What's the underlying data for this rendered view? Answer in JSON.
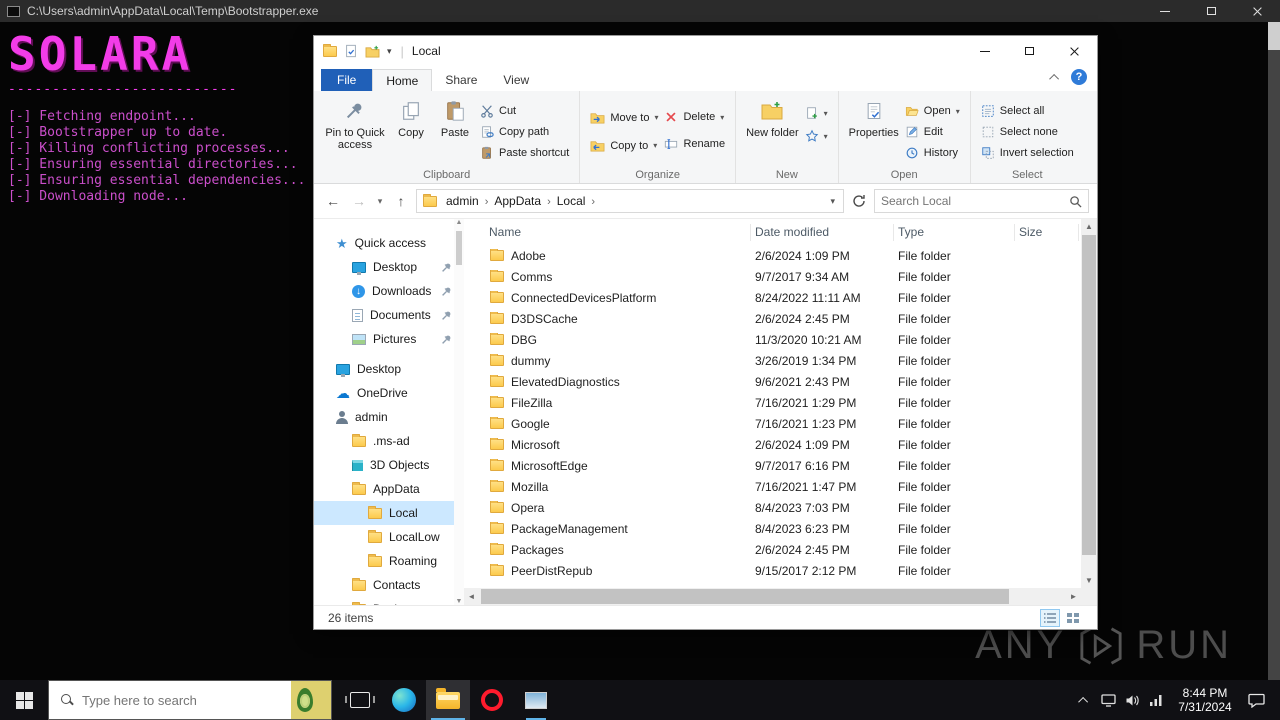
{
  "console": {
    "title": "C:\\Users\\admin\\AppData\\Local\\Temp\\Bootstrapper.exe",
    "logo_text": "SOLARA",
    "divider": "--------------------------",
    "lines": [
      "[-] Fetching endpoint...",
      "[-] Bootstrapper up to date.",
      "[-] Killing conflicting processes...",
      "[-] Ensuring essential directories...",
      "[-] Ensuring essential dependencies...",
      "[-] Downloading node..."
    ],
    "colors": {
      "logo": "#f23ce8",
      "text": "#cb4fcb",
      "titlebar": "#2b2b2b"
    }
  },
  "explorer": {
    "window_title": "Local",
    "tabs": {
      "file": "File",
      "home": "Home",
      "share": "Share",
      "view": "View"
    },
    "ribbon": {
      "pin": "Pin to Quick access",
      "copy": "Copy",
      "paste": "Paste",
      "cut": "Cut",
      "copy_path": "Copy path",
      "paste_shortcut": "Paste shortcut",
      "move_to": "Move to",
      "copy_to": "Copy to",
      "delete": "Delete",
      "rename": "Rename",
      "new_folder": "New folder",
      "properties": "Properties",
      "open": "Open",
      "edit": "Edit",
      "history": "History",
      "select_all": "Select all",
      "select_none": "Select none",
      "invert_selection": "Invert selection",
      "groups": {
        "clipboard": "Clipboard",
        "organize": "Organize",
        "new": "New",
        "open": "Open",
        "select": "Select"
      }
    },
    "address": {
      "crumbs": [
        "admin",
        "AppData",
        "Local"
      ]
    },
    "search_placeholder": "Search Local",
    "sidebar": {
      "quick_access": "Quick access",
      "items": [
        {
          "label": "Desktop",
          "icon": "desktop",
          "level": 1,
          "pinned": true
        },
        {
          "label": "Downloads",
          "icon": "downloads",
          "level": 1,
          "pinned": true
        },
        {
          "label": "Documents",
          "icon": "documents",
          "level": 1,
          "pinned": true
        },
        {
          "label": "Pictures",
          "icon": "pictures",
          "level": 1,
          "pinned": true
        },
        {
          "label": "Desktop",
          "icon": "desktop",
          "level": 0,
          "gap_before": true
        },
        {
          "label": "OneDrive",
          "icon": "onedrive",
          "level": 0
        },
        {
          "label": "admin",
          "icon": "user",
          "level": 0
        },
        {
          "label": ".ms-ad",
          "icon": "folder",
          "level": 1
        },
        {
          "label": "3D Objects",
          "icon": "cube",
          "level": 1
        },
        {
          "label": "AppData",
          "icon": "folder",
          "level": 1
        },
        {
          "label": "Local",
          "icon": "folder",
          "level": 2,
          "selected": true
        },
        {
          "label": "LocalLow",
          "icon": "folder",
          "level": 2
        },
        {
          "label": "Roaming",
          "icon": "folder",
          "level": 2
        },
        {
          "label": "Contacts",
          "icon": "folder",
          "level": 1
        },
        {
          "label": "Desktop",
          "icon": "folder",
          "level": 1
        }
      ]
    },
    "files": {
      "columns": [
        "Name",
        "Date modified",
        "Type",
        "Size"
      ],
      "rows": [
        {
          "name": "Adobe",
          "modified": "2/6/2024 1:09 PM",
          "type": "File folder",
          "size": ""
        },
        {
          "name": "Comms",
          "modified": "9/7/2017 9:34 AM",
          "type": "File folder",
          "size": ""
        },
        {
          "name": "ConnectedDevicesPlatform",
          "modified": "8/24/2022 11:11 AM",
          "type": "File folder",
          "size": ""
        },
        {
          "name": "D3DSCache",
          "modified": "2/6/2024 2:45 PM",
          "type": "File folder",
          "size": ""
        },
        {
          "name": "DBG",
          "modified": "11/3/2020 10:21 AM",
          "type": "File folder",
          "size": ""
        },
        {
          "name": "dummy",
          "modified": "3/26/2019 1:34 PM",
          "type": "File folder",
          "size": ""
        },
        {
          "name": "ElevatedDiagnostics",
          "modified": "9/6/2021 2:43 PM",
          "type": "File folder",
          "size": ""
        },
        {
          "name": "FileZilla",
          "modified": "7/16/2021 1:29 PM",
          "type": "File folder",
          "size": ""
        },
        {
          "name": "Google",
          "modified": "7/16/2021 1:23 PM",
          "type": "File folder",
          "size": ""
        },
        {
          "name": "Microsoft",
          "modified": "2/6/2024 1:09 PM",
          "type": "File folder",
          "size": ""
        },
        {
          "name": "MicrosoftEdge",
          "modified": "9/7/2017 6:16 PM",
          "type": "File folder",
          "size": ""
        },
        {
          "name": "Mozilla",
          "modified": "7/16/2021 1:47 PM",
          "type": "File folder",
          "size": ""
        },
        {
          "name": "Opera",
          "modified": "8/4/2023 7:03 PM",
          "type": "File folder",
          "size": ""
        },
        {
          "name": "PackageManagement",
          "modified": "8/4/2023 6:23 PM",
          "type": "File folder",
          "size": ""
        },
        {
          "name": "Packages",
          "modified": "2/6/2024 2:45 PM",
          "type": "File folder",
          "size": ""
        },
        {
          "name": "PeerDistRepub",
          "modified": "9/15/2017 2:12 PM",
          "type": "File folder",
          "size": ""
        }
      ]
    },
    "status": {
      "items": "26 items"
    }
  },
  "taskbar": {
    "search_placeholder": "Type here to search",
    "clock": {
      "time": "8:44 PM",
      "date": "7/31/2024"
    }
  },
  "watermark": {
    "left": "ANY",
    "right": "RUN"
  },
  "icons": {
    "caret_down": "▾",
    "crumb_sep": "›",
    "back": "←",
    "forward": "→",
    "up": "↑",
    "star": "★",
    "cloud": "☁",
    "down_arrow": "↓",
    "help": "?",
    "scroll_up": "▲",
    "scroll_down": "▼",
    "scroll_left": "◄",
    "scroll_right": "►"
  }
}
